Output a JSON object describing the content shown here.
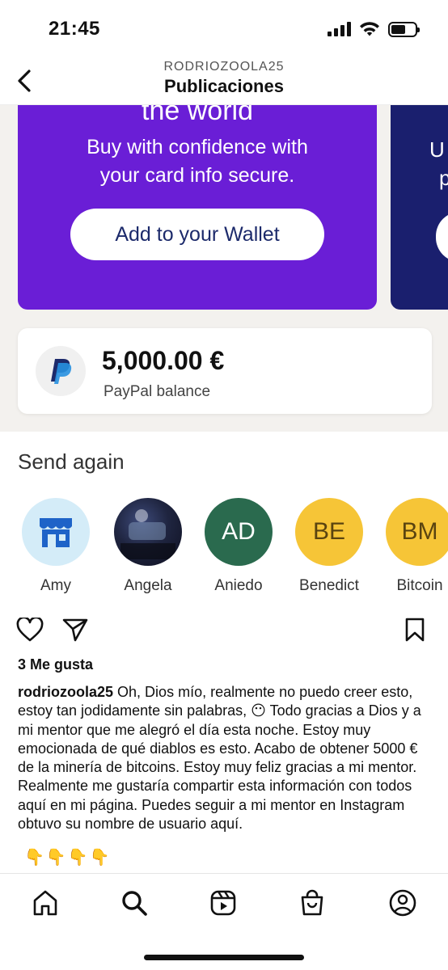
{
  "status_bar": {
    "time": "21:45"
  },
  "header": {
    "username": "RODRIOZOOLA25",
    "title": "Publicaciones"
  },
  "post_image": {
    "promo": {
      "heading": "the world",
      "line1": "Buy with confidence with",
      "line2": "your card info secure.",
      "button_label": "Add to your Wallet",
      "next_card_peek_line1": "U",
      "next_card_peek_line2": "p"
    },
    "balance": {
      "amount": "5,000.00 €",
      "label": "PayPal balance"
    },
    "send_again": {
      "title": "Send again",
      "contacts": [
        {
          "name": "Amy",
          "initials": ""
        },
        {
          "name": "Angela",
          "initials": ""
        },
        {
          "name": "Aniedo",
          "initials": "AD"
        },
        {
          "name": "Benedict",
          "initials": "BE"
        },
        {
          "name": "Bitcoin",
          "initials": "BM"
        }
      ]
    }
  },
  "post": {
    "likes": "3 Me gusta",
    "caption_user": "rodriozoola25",
    "caption_text": "Oh, Dios mío, realmente no puedo creer esto, estoy tan jodidamente sin palabras, 😶 Todo gracias a Dios y a mi mentor que me alegró el día esta noche.  Estoy muy emocionada de qué diablos es esto. Acabo de obtener 5000 € de la minería de bitcoins. Estoy muy feliz gracias a mi mentor. Realmente me gustaría compartir esta información con todos aquí en mi página. Puedes seguir a mi mentor en  Instagram obtuvo su nombre de usuario aquí.",
    "emojis": "👇👇👇👇"
  },
  "colors": {
    "promo_purple": "#6a1ed6",
    "promo_navy": "#1a1f6e",
    "paypal_blue": "#1c2a6b",
    "avatar_green": "#2a6a4e",
    "avatar_yellow": "#f6c537"
  },
  "icons": {
    "header": [
      "back-chevron-icon"
    ],
    "actions": [
      "heart-icon",
      "send-icon",
      "bookmark-icon"
    ],
    "tabs": [
      "home-icon",
      "search-icon",
      "reels-icon",
      "shop-icon",
      "profile-icon"
    ]
  }
}
